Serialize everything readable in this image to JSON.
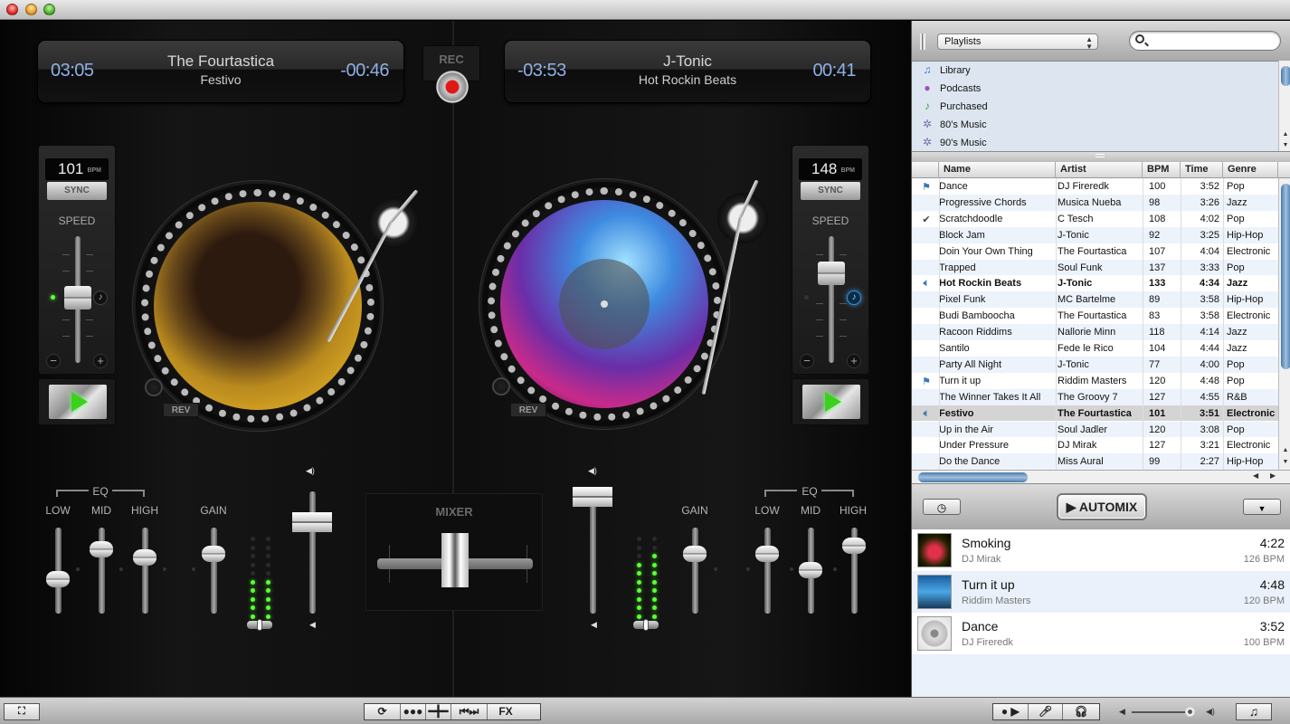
{
  "window": {
    "buttons": [
      "close",
      "minimize",
      "zoom"
    ]
  },
  "deck_a": {
    "artist": "The Fourtastica",
    "title": "Festivo",
    "elapsed": "03:05",
    "remaining": "-00:46",
    "bpm": "101",
    "bpm_unit": "BPM",
    "sync_label": "SYNC",
    "speed_label": "SPEED",
    "speed_minus": "−",
    "speed_plus": "+",
    "rev_label": "REV",
    "artwork": "afro-woman-artwork",
    "pitch_led": "on",
    "beat_icon": "off"
  },
  "deck_b": {
    "artist": "J-Tonic",
    "title": "Hot Rockin Beats",
    "elapsed": "-03:53",
    "remaining": "00:41",
    "bpm": "148",
    "bpm_unit": "BPM",
    "sync_label": "SYNC",
    "speed_label": "SPEED",
    "speed_minus": "−",
    "speed_plus": "+",
    "rev_label": "REV",
    "artwork": "dancing-crowd-artwork",
    "pitch_led": "off",
    "beat_icon": "on"
  },
  "rec_label": "REC",
  "mixer": {
    "title": "MIXER",
    "eq_label": "EQ",
    "low": "LOW",
    "mid": "MID",
    "high": "HIGH",
    "gain": "GAIN",
    "crossfader_position": 0.5
  },
  "bottom_toolbar": {
    "left": [
      "fullscreen"
    ],
    "center": [
      "loop",
      "samples",
      "crossfade",
      "skip",
      "FX"
    ],
    "fx_label": "FX",
    "right": [
      "record-play",
      "microphone",
      "headphones"
    ],
    "volume": 0.92,
    "itunes": "music-note"
  },
  "browser": {
    "source_select": "Playlists",
    "search_placeholder": "",
    "playlists": [
      {
        "icon": "♫",
        "label": "Library"
      },
      {
        "icon": "●",
        "label": "Podcasts"
      },
      {
        "icon": "♪",
        "label": "Purchased"
      },
      {
        "icon": "✲",
        "label": "80's Music"
      },
      {
        "icon": "✲",
        "label": "90's Music"
      }
    ],
    "columns": [
      "Name",
      "Artist",
      "BPM",
      "Time",
      "Genre"
    ],
    "tracks": [
      {
        "icon": "flag",
        "name": "Dance",
        "artist": "DJ Fireredk",
        "bpm": "100",
        "time": "3:52",
        "genre": "Pop"
      },
      {
        "icon": "",
        "name": "Progressive Chords",
        "artist": "Musica Nueba",
        "bpm": "98",
        "time": "3:26",
        "genre": "Jazz"
      },
      {
        "icon": "check",
        "name": "Scratchdoodle",
        "artist": "C Tesch",
        "bpm": "108",
        "time": "4:02",
        "genre": "Pop"
      },
      {
        "icon": "",
        "name": "Block Jam",
        "artist": "J-Tonic",
        "bpm": "92",
        "time": "3:25",
        "genre": "Hip-Hop"
      },
      {
        "icon": "",
        "name": "Doin Your Own Thing",
        "artist": "The Fourtastica",
        "bpm": "107",
        "time": "4:04",
        "genre": "Electronic"
      },
      {
        "icon": "",
        "name": "Trapped",
        "artist": "Soul Funk",
        "bpm": "137",
        "time": "3:33",
        "genre": "Pop"
      },
      {
        "icon": "speaker",
        "name": "Hot Rockin Beats",
        "artist": "J-Tonic",
        "bpm": "133",
        "time": "4:34",
        "genre": "Jazz",
        "playing": true
      },
      {
        "icon": "",
        "name": "Pixel Funk",
        "artist": "MC Bartelme",
        "bpm": "89",
        "time": "3:58",
        "genre": "Hip-Hop"
      },
      {
        "icon": "",
        "name": "Budi Bamboocha",
        "artist": "The Fourtastica",
        "bpm": "83",
        "time": "3:58",
        "genre": "Electronic"
      },
      {
        "icon": "",
        "name": "Racoon Riddims",
        "artist": "Nallorie Minn",
        "bpm": "118",
        "time": "4:14",
        "genre": "Jazz"
      },
      {
        "icon": "",
        "name": "Santilo",
        "artist": "Fede le Rico",
        "bpm": "104",
        "time": "4:44",
        "genre": "Jazz"
      },
      {
        "icon": "",
        "name": "Party All Night",
        "artist": "J-Tonic",
        "bpm": "77",
        "time": "4:00",
        "genre": "Pop"
      },
      {
        "icon": "flag",
        "name": "Turn it up",
        "artist": "Riddim Masters",
        "bpm": "120",
        "time": "4:48",
        "genre": "Pop"
      },
      {
        "icon": "",
        "name": "The Winner Takes It All",
        "artist": "The Groovy 7",
        "bpm": "127",
        "time": "4:55",
        "genre": "R&B"
      },
      {
        "icon": "speaker",
        "name": "Festivo",
        "artist": "The Fourtastica",
        "bpm": "101",
        "time": "3:51",
        "genre": "Electronic",
        "playing": true,
        "selected": true
      },
      {
        "icon": "",
        "name": "Up in the Air",
        "artist": "Soul Jadler",
        "bpm": "120",
        "time": "3:08",
        "genre": "Pop"
      },
      {
        "icon": "",
        "name": "Under Pressure",
        "artist": "DJ Mirak",
        "bpm": "127",
        "time": "3:21",
        "genre": "Electronic"
      },
      {
        "icon": "",
        "name": "Do the Dance",
        "artist": "Miss Aural",
        "bpm": "99",
        "time": "2:27",
        "genre": "Hip-Hop"
      }
    ],
    "automix_label": "AUTOMIX",
    "queue": [
      {
        "title": "Smoking",
        "artist": "DJ Mirak",
        "time": "4:22",
        "bpm": "126 BPM",
        "art": "red-dancer"
      },
      {
        "title": "Turn it up",
        "artist": "Riddim Masters",
        "time": "4:48",
        "bpm": "120 BPM",
        "art": "blue-crowd"
      },
      {
        "title": "Dance",
        "artist": "DJ Fireredk",
        "time": "3:52",
        "bpm": "100 BPM",
        "art": "blank-cd"
      }
    ]
  }
}
